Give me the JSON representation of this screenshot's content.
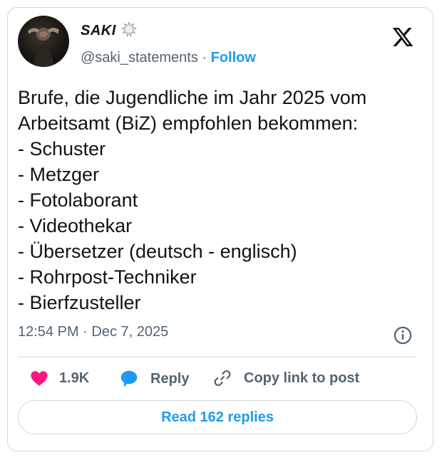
{
  "author": {
    "display_name": "SAKI",
    "handle": "@saki_statements",
    "separator": " · ",
    "follow_label": "Follow",
    "name_emoji_icon": "anger-burst-icon"
  },
  "tweet": {
    "lines": [
      "Brufe, die Jugendliche im Jahr 2025 vom",
      "Arbeitsamt (BiZ) empfohlen bekommen:",
      "- Schuster",
      "- Metzger",
      "- Fotolaborant",
      "- Videothekar",
      "- Übersetzer (deutsch - englisch)",
      "- Rohrpost-Techniker",
      "- Bierfzusteller"
    ],
    "time": "12:54 PM",
    "date_separator": " · ",
    "date": "Dec 7, 2025"
  },
  "actions": {
    "like_count": "1.9K",
    "reply_label": "Reply",
    "copy_link_label": "Copy link to post"
  },
  "footer": {
    "read_replies_label": "Read 162 replies"
  },
  "colors": {
    "accent": "#1d9bf0",
    "like": "#f91880",
    "text": "#0f1419",
    "secondary_text": "#536471",
    "border": "#cfd9de"
  }
}
